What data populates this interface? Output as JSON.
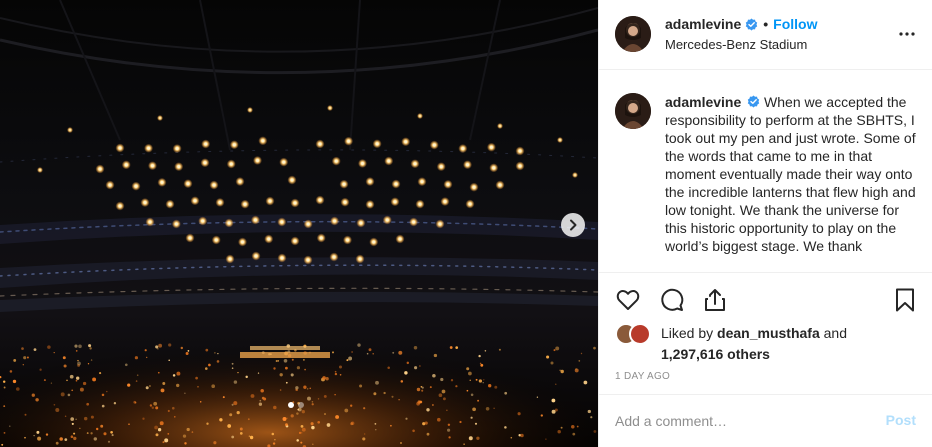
{
  "post": {
    "username": "adamlevine",
    "verified": true,
    "follow_label": "Follow",
    "separator": "•",
    "location": "Mercedes-Benz Stadium",
    "caption": "When we accepted the responsibility to perform at the SBHTS, I took out my pen and just wrote. Some of the words that came to me in that moment eventually made their way onto the incredible lanterns that flew high and low tonight. We thank the universe for this historic opportunity to play on the world’s biggest stage. We thank",
    "likes": {
      "prefix": "Liked by",
      "first_user": "dean_musthafa",
      "joiner": "and",
      "others_count": "1,297,616 others"
    },
    "timestamp": "1 DAY AGO"
  },
  "carousel": {
    "current": 1,
    "total": 2
  },
  "comment": {
    "placeholder": "Add a comment…",
    "post_label": "Post"
  },
  "icons": {
    "next": "chevron-right-icon",
    "more": "more-options-icon",
    "like": "heart-icon",
    "comment": "comment-bubble-icon",
    "share": "share-icon",
    "save": "bookmark-icon",
    "verified": "verified-badge-icon"
  },
  "colors": {
    "accent": "#0095f6",
    "post_disabled": "#b2dffc",
    "muted": "#8e8e8e",
    "verified": "#3897f0"
  }
}
